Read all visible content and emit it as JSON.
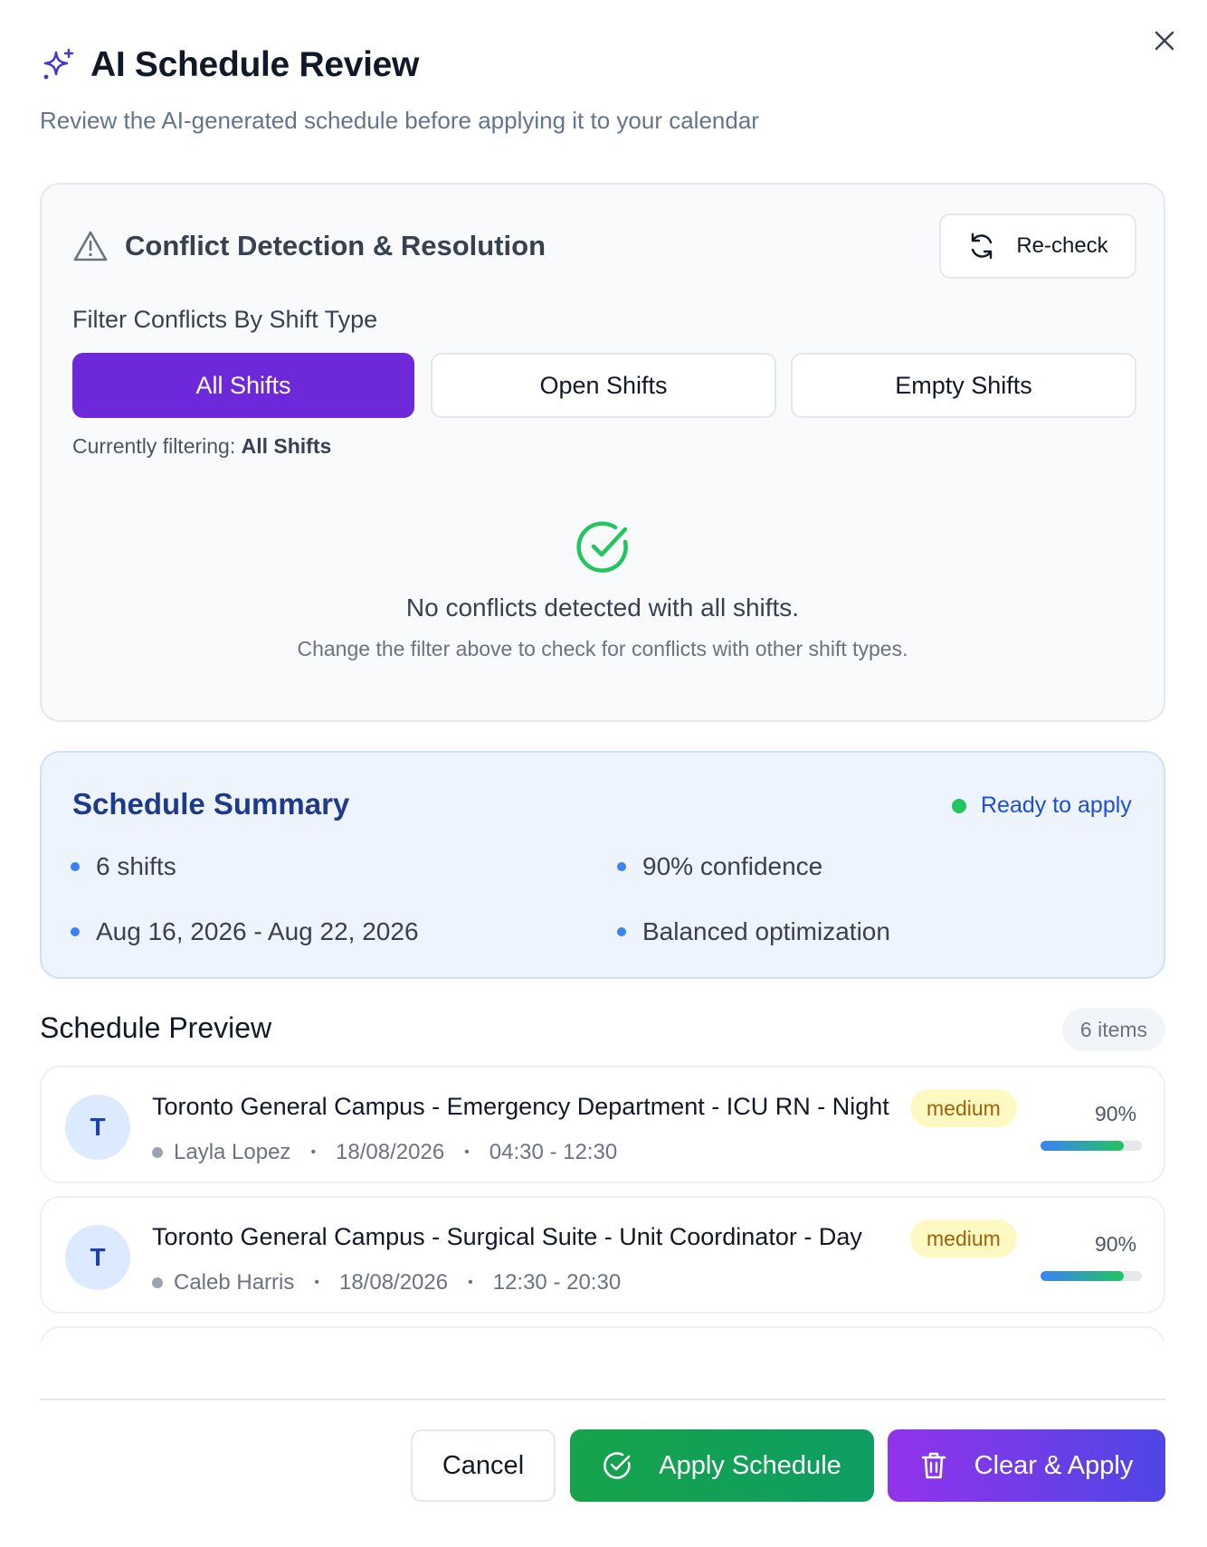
{
  "dialog": {
    "title": "AI Schedule Review",
    "subtitle": "Review the AI-generated schedule before applying it to your calendar",
    "icons": {
      "title": "sparkles-icon",
      "close": "close-icon"
    }
  },
  "conflicts": {
    "title": "Conflict Detection & Resolution",
    "recheck_label": "Re-check",
    "filter_label": "Filter Conflicts By Shift Type",
    "filters": [
      "All Shifts",
      "Open Shifts",
      "Empty Shifts"
    ],
    "active_filter": "All Shifts",
    "filtering_prefix": "Currently filtering:",
    "filtering_value": "All Shifts",
    "empty_title": "No conflicts detected with all shifts.",
    "empty_subtitle": "Change the filter above to check for conflicts with other shift types.",
    "icons": {
      "header": "warning-triangle-icon",
      "recheck": "refresh-icon",
      "empty": "check-circle-icon"
    }
  },
  "summary": {
    "title": "Schedule Summary",
    "status": "Ready to apply",
    "items": [
      "6 shifts",
      "90% confidence",
      "Aug 16, 2026 - Aug 22, 2026",
      "Balanced optimization"
    ]
  },
  "preview": {
    "title": "Schedule Preview",
    "count_label": "6 items",
    "rows": [
      {
        "avatar": "T",
        "title": "Toronto General Campus - Emergency Department - ICU RN - Night",
        "priority": "medium",
        "employee": "Layla Lopez",
        "date": "18/08/2026",
        "time": "04:30 - 12:30",
        "confidence_label": "90%",
        "confidence": 0.82
      },
      {
        "avatar": "T",
        "title": "Toronto General Campus - Surgical Suite - Unit Coordinator - Day",
        "priority": "medium",
        "employee": "Caleb Harris",
        "date": "18/08/2026",
        "time": "12:30 - 20:30",
        "confidence_label": "90%",
        "confidence": 0.82
      }
    ]
  },
  "footer": {
    "cancel": "Cancel",
    "apply": "Apply Schedule",
    "clear_apply": "Clear & Apply",
    "icons": {
      "apply": "check-circle-icon",
      "clear": "trash-icon"
    }
  },
  "colors": {
    "primary": "#6d28d9",
    "success": "#16a34a",
    "summary_bg": "#eef4fe",
    "badge_bg": "#fef9c3"
  }
}
